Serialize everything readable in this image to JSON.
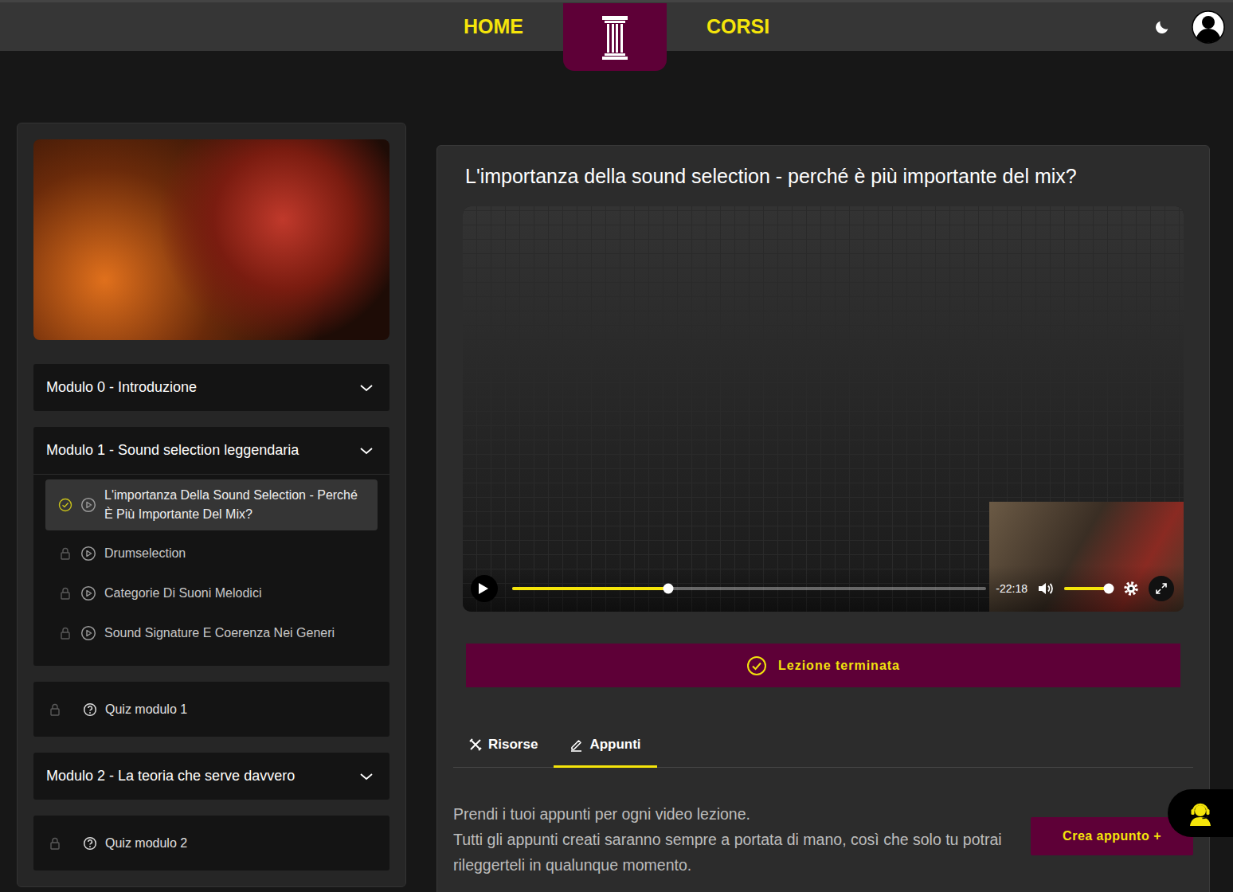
{
  "nav": {
    "links": [
      {
        "label": "HOME"
      },
      {
        "label": "CORSI"
      }
    ]
  },
  "sidebar": {
    "modules": [
      {
        "kind": "module",
        "title": "Modulo 0 - Introduzione",
        "expanded": false,
        "lessons": []
      },
      {
        "kind": "module",
        "title": "Modulo 1 - Sound selection leggendaria",
        "expanded": true,
        "lessons": [
          {
            "title": "L'importanza Della Sound Selection - Perché È Più Importante Del Mix?",
            "selected": true,
            "completed": true,
            "locked": false
          },
          {
            "title": "Drumselection",
            "selected": false,
            "completed": false,
            "locked": true
          },
          {
            "title": "Categorie Di Suoni Melodici",
            "selected": false,
            "completed": false,
            "locked": true
          },
          {
            "title": "Sound Signature E Coerenza Nei Generi",
            "selected": false,
            "completed": false,
            "locked": true
          }
        ]
      },
      {
        "kind": "quiz",
        "title": "Quiz modulo 1",
        "locked": true
      },
      {
        "kind": "module",
        "title": "Modulo 2 - La teoria che serve davvero",
        "expanded": false,
        "lessons": []
      },
      {
        "kind": "quiz",
        "title": "Quiz modulo 2",
        "locked": true
      }
    ]
  },
  "lesson": {
    "title": "L'importanza della sound selection - perché è più importante del mix?",
    "video": {
      "playing": false,
      "level": 0.33,
      "remaining": "-22:18",
      "volume": 0.9
    },
    "complete_button": {
      "label": "Lezione terminata",
      "completed": true
    },
    "tabs": [
      {
        "label": "Risorse",
        "selected": false
      },
      {
        "label": "Appunti",
        "selected": true
      }
    ],
    "notes": {
      "lines": [
        "Prendi i tuoi appunti per ogni video lezione.",
        "Tutti gli appunti creati saranno sempre a portata di mano, così che solo tu potrai rileggerteli in qualunque momento."
      ],
      "button": "Crea appunto +"
    }
  }
}
